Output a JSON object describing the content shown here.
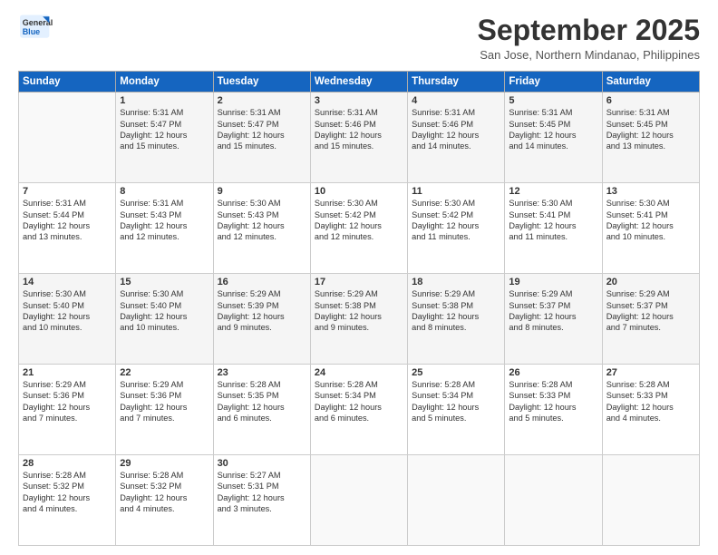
{
  "logo": {
    "line1": "General",
    "line2": "Blue"
  },
  "title": "September 2025",
  "subtitle": "San Jose, Northern Mindanao, Philippines",
  "days": [
    "Sunday",
    "Monday",
    "Tuesday",
    "Wednesday",
    "Thursday",
    "Friday",
    "Saturday"
  ],
  "weeks": [
    [
      {
        "num": "",
        "lines": []
      },
      {
        "num": "1",
        "lines": [
          "Sunrise: 5:31 AM",
          "Sunset: 5:47 PM",
          "Daylight: 12 hours",
          "and 15 minutes."
        ]
      },
      {
        "num": "2",
        "lines": [
          "Sunrise: 5:31 AM",
          "Sunset: 5:47 PM",
          "Daylight: 12 hours",
          "and 15 minutes."
        ]
      },
      {
        "num": "3",
        "lines": [
          "Sunrise: 5:31 AM",
          "Sunset: 5:46 PM",
          "Daylight: 12 hours",
          "and 15 minutes."
        ]
      },
      {
        "num": "4",
        "lines": [
          "Sunrise: 5:31 AM",
          "Sunset: 5:46 PM",
          "Daylight: 12 hours",
          "and 14 minutes."
        ]
      },
      {
        "num": "5",
        "lines": [
          "Sunrise: 5:31 AM",
          "Sunset: 5:45 PM",
          "Daylight: 12 hours",
          "and 14 minutes."
        ]
      },
      {
        "num": "6",
        "lines": [
          "Sunrise: 5:31 AM",
          "Sunset: 5:45 PM",
          "Daylight: 12 hours",
          "and 13 minutes."
        ]
      }
    ],
    [
      {
        "num": "7",
        "lines": [
          "Sunrise: 5:31 AM",
          "Sunset: 5:44 PM",
          "Daylight: 12 hours",
          "and 13 minutes."
        ]
      },
      {
        "num": "8",
        "lines": [
          "Sunrise: 5:31 AM",
          "Sunset: 5:43 PM",
          "Daylight: 12 hours",
          "and 12 minutes."
        ]
      },
      {
        "num": "9",
        "lines": [
          "Sunrise: 5:30 AM",
          "Sunset: 5:43 PM",
          "Daylight: 12 hours",
          "and 12 minutes."
        ]
      },
      {
        "num": "10",
        "lines": [
          "Sunrise: 5:30 AM",
          "Sunset: 5:42 PM",
          "Daylight: 12 hours",
          "and 12 minutes."
        ]
      },
      {
        "num": "11",
        "lines": [
          "Sunrise: 5:30 AM",
          "Sunset: 5:42 PM",
          "Daylight: 12 hours",
          "and 11 minutes."
        ]
      },
      {
        "num": "12",
        "lines": [
          "Sunrise: 5:30 AM",
          "Sunset: 5:41 PM",
          "Daylight: 12 hours",
          "and 11 minutes."
        ]
      },
      {
        "num": "13",
        "lines": [
          "Sunrise: 5:30 AM",
          "Sunset: 5:41 PM",
          "Daylight: 12 hours",
          "and 10 minutes."
        ]
      }
    ],
    [
      {
        "num": "14",
        "lines": [
          "Sunrise: 5:30 AM",
          "Sunset: 5:40 PM",
          "Daylight: 12 hours",
          "and 10 minutes."
        ]
      },
      {
        "num": "15",
        "lines": [
          "Sunrise: 5:30 AM",
          "Sunset: 5:40 PM",
          "Daylight: 12 hours",
          "and 10 minutes."
        ]
      },
      {
        "num": "16",
        "lines": [
          "Sunrise: 5:29 AM",
          "Sunset: 5:39 PM",
          "Daylight: 12 hours",
          "and 9 minutes."
        ]
      },
      {
        "num": "17",
        "lines": [
          "Sunrise: 5:29 AM",
          "Sunset: 5:38 PM",
          "Daylight: 12 hours",
          "and 9 minutes."
        ]
      },
      {
        "num": "18",
        "lines": [
          "Sunrise: 5:29 AM",
          "Sunset: 5:38 PM",
          "Daylight: 12 hours",
          "and 8 minutes."
        ]
      },
      {
        "num": "19",
        "lines": [
          "Sunrise: 5:29 AM",
          "Sunset: 5:37 PM",
          "Daylight: 12 hours",
          "and 8 minutes."
        ]
      },
      {
        "num": "20",
        "lines": [
          "Sunrise: 5:29 AM",
          "Sunset: 5:37 PM",
          "Daylight: 12 hours",
          "and 7 minutes."
        ]
      }
    ],
    [
      {
        "num": "21",
        "lines": [
          "Sunrise: 5:29 AM",
          "Sunset: 5:36 PM",
          "Daylight: 12 hours",
          "and 7 minutes."
        ]
      },
      {
        "num": "22",
        "lines": [
          "Sunrise: 5:29 AM",
          "Sunset: 5:36 PM",
          "Daylight: 12 hours",
          "and 7 minutes."
        ]
      },
      {
        "num": "23",
        "lines": [
          "Sunrise: 5:28 AM",
          "Sunset: 5:35 PM",
          "Daylight: 12 hours",
          "and 6 minutes."
        ]
      },
      {
        "num": "24",
        "lines": [
          "Sunrise: 5:28 AM",
          "Sunset: 5:34 PM",
          "Daylight: 12 hours",
          "and 6 minutes."
        ]
      },
      {
        "num": "25",
        "lines": [
          "Sunrise: 5:28 AM",
          "Sunset: 5:34 PM",
          "Daylight: 12 hours",
          "and 5 minutes."
        ]
      },
      {
        "num": "26",
        "lines": [
          "Sunrise: 5:28 AM",
          "Sunset: 5:33 PM",
          "Daylight: 12 hours",
          "and 5 minutes."
        ]
      },
      {
        "num": "27",
        "lines": [
          "Sunrise: 5:28 AM",
          "Sunset: 5:33 PM",
          "Daylight: 12 hours",
          "and 4 minutes."
        ]
      }
    ],
    [
      {
        "num": "28",
        "lines": [
          "Sunrise: 5:28 AM",
          "Sunset: 5:32 PM",
          "Daylight: 12 hours",
          "and 4 minutes."
        ]
      },
      {
        "num": "29",
        "lines": [
          "Sunrise: 5:28 AM",
          "Sunset: 5:32 PM",
          "Daylight: 12 hours",
          "and 4 minutes."
        ]
      },
      {
        "num": "30",
        "lines": [
          "Sunrise: 5:27 AM",
          "Sunset: 5:31 PM",
          "Daylight: 12 hours",
          "and 3 minutes."
        ]
      },
      {
        "num": "",
        "lines": []
      },
      {
        "num": "",
        "lines": []
      },
      {
        "num": "",
        "lines": []
      },
      {
        "num": "",
        "lines": []
      }
    ]
  ]
}
